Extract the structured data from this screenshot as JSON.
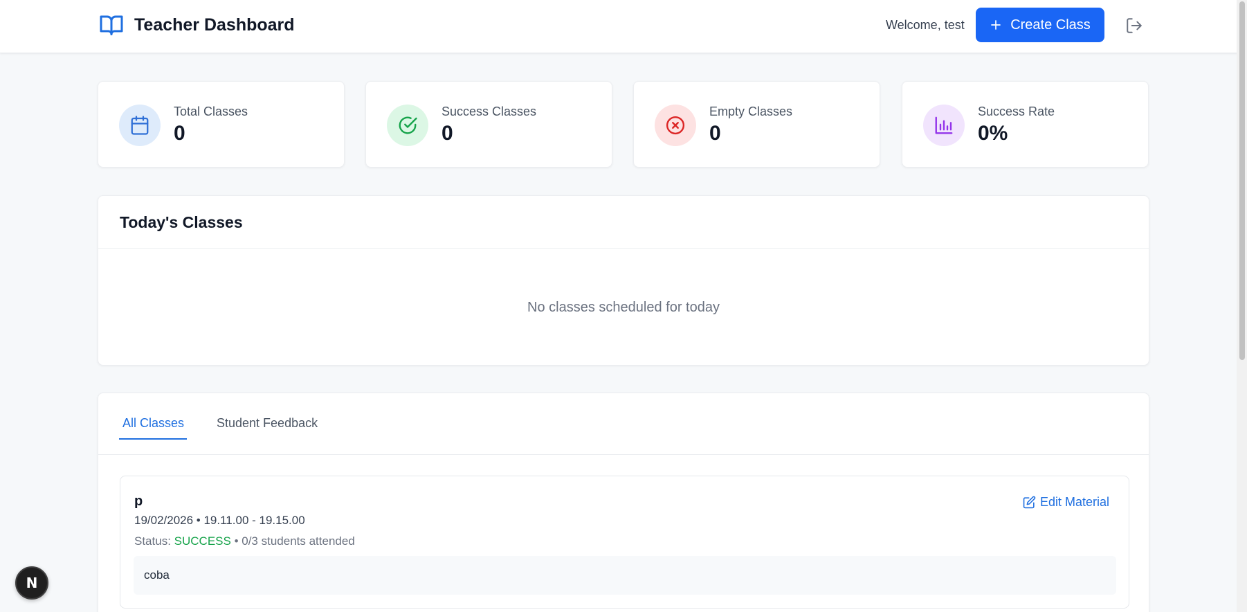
{
  "header": {
    "title": "Teacher Dashboard",
    "welcome": "Welcome, test",
    "create_label": "Create Class"
  },
  "stats": [
    {
      "label": "Total Classes",
      "value": "0",
      "icon": "calendar-icon",
      "color": "#2f6fd6",
      "bg": "#deebfb"
    },
    {
      "label": "Success Classes",
      "value": "0",
      "icon": "check-circle-icon",
      "color": "#16a34a",
      "bg": "#dcf7e5"
    },
    {
      "label": "Empty Classes",
      "value": "0",
      "icon": "x-circle-icon",
      "color": "#dc2626",
      "bg": "#fde2e2"
    },
    {
      "label": "Success Rate",
      "value": "0%",
      "icon": "bar-chart-icon",
      "color": "#9333ea",
      "bg": "#f1e4fd"
    }
  ],
  "today": {
    "title": "Today's Classes",
    "empty_text": "No classes scheduled for today"
  },
  "tabs": [
    {
      "label": "All Classes",
      "active": true
    },
    {
      "label": "Student Feedback",
      "active": false
    }
  ],
  "classes": [
    {
      "name": "p",
      "schedule": "19/02/2026 • 19.11.00 - 19.15.00",
      "status_prefix": "Status:",
      "status": "SUCCESS",
      "attendance": "• 0/3 students attended",
      "edit_label": "Edit Material",
      "note": "coba"
    }
  ],
  "badge": {
    "letter": "N"
  },
  "colors": {
    "accent": "#1a66f5",
    "link": "#1f6fe0",
    "success": "#16a34a"
  }
}
